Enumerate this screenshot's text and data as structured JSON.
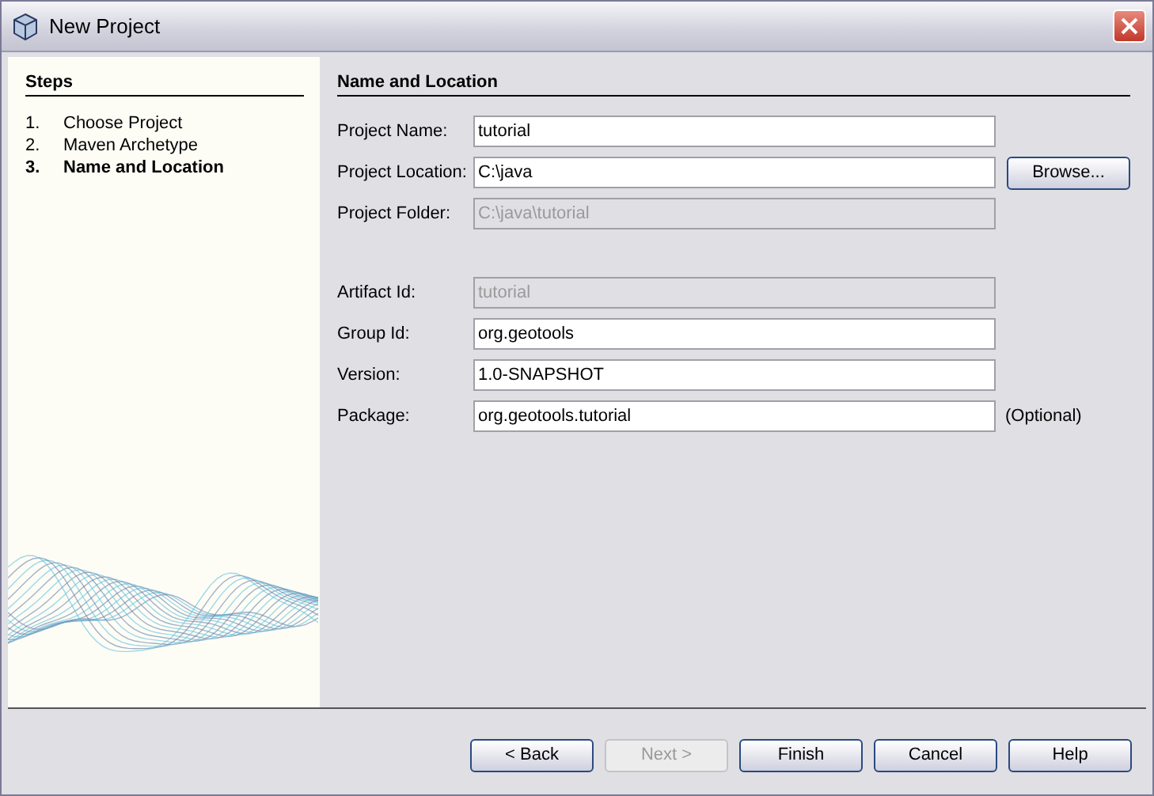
{
  "window": {
    "title": "New Project"
  },
  "steps": {
    "title": "Steps",
    "items": [
      {
        "number": "1.",
        "label": "Choose Project",
        "selected": false
      },
      {
        "number": "2.",
        "label": "Maven Archetype",
        "selected": false
      },
      {
        "number": "3.",
        "label": "Name and Location",
        "selected": true
      }
    ]
  },
  "panel": {
    "title": "Name and Location",
    "groups": [
      [
        {
          "label": "Project Name:",
          "value": "tutorial",
          "disabled": false
        },
        {
          "label": "Project Location:",
          "value": "C:\\java",
          "disabled": false,
          "button": "Browse..."
        },
        {
          "label": "Project Folder:",
          "value": "C:\\java\\tutorial",
          "disabled": true
        }
      ],
      [
        {
          "label": "Artifact Id:",
          "value": "tutorial",
          "disabled": true
        },
        {
          "label": "Group Id:",
          "value": "org.geotools",
          "disabled": false
        },
        {
          "label": "Version:",
          "value": "1.0-SNAPSHOT",
          "disabled": false
        },
        {
          "label": "Package:",
          "value": "org.geotools.tutorial",
          "disabled": false,
          "note": "(Optional)"
        }
      ]
    ]
  },
  "buttons": [
    {
      "label": "< Back",
      "disabled": false
    },
    {
      "label": "Next >",
      "disabled": true
    },
    {
      "label": "Finish",
      "disabled": false
    },
    {
      "label": "Cancel",
      "disabled": false
    },
    {
      "label": "Help",
      "disabled": false
    }
  ]
}
